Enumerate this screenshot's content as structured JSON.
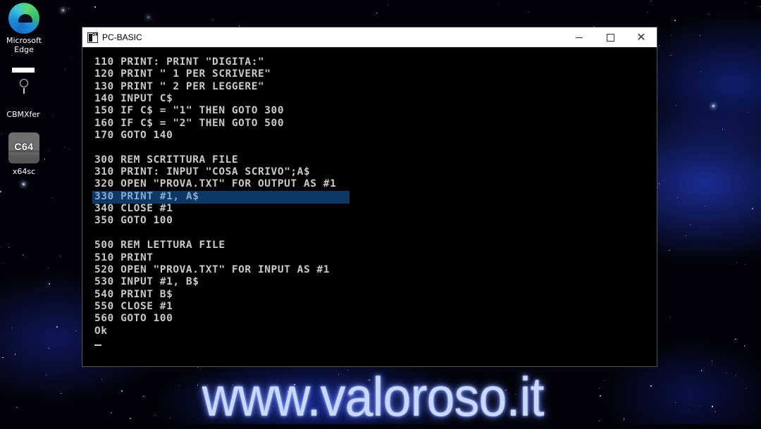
{
  "desktop": {
    "icons": [
      {
        "label_line1": "Microsoft",
        "label_line2": "Edge",
        "icon": "edge-browser-icon"
      },
      {
        "label_line1": "CBMXfer",
        "icon": "cbmxfer-icon"
      },
      {
        "label_line1": "x64sc",
        "badge": "C64",
        "icon": "c64-emulator-icon"
      }
    ]
  },
  "window": {
    "title": "PC-BASIC",
    "controls": {
      "minimize": "minimize",
      "maximize": "maximize",
      "close": "close"
    }
  },
  "terminal": {
    "highlight_color": "#0c3864",
    "text_color": "#c9c9c9",
    "lines": [
      "110 PRINT: PRINT \"DIGITA:\"",
      "120 PRINT \" 1 PER SCRIVERE\"",
      "130 PRINT \" 2 PER LEGGERE\"",
      "140 INPUT C$",
      "150 IF C$ = \"1\" THEN GOTO 300",
      "160 IF C$ = \"2\" THEN GOTO 500",
      "170 GOTO 140",
      "",
      "300 REM SCRITTURA FILE",
      "310 PRINT: INPUT \"COSA SCRIVO\";A$",
      "320 OPEN \"PROVA.TXT\" FOR OUTPUT AS #1",
      "330 PRINT #1, A$",
      "340 CLOSE #1",
      "350 GOTO 100",
      "",
      "500 REM LETTURA FILE",
      "510 PRINT",
      "520 OPEN \"PROVA.TXT\" FOR INPUT AS #1",
      "530 INPUT #1, B$",
      "540 PRINT B$",
      "550 CLOSE #1",
      "560 GOTO 100",
      "Ok"
    ],
    "highlighted_line_index": 11
  },
  "watermark": {
    "text": "www.valoroso.it"
  }
}
